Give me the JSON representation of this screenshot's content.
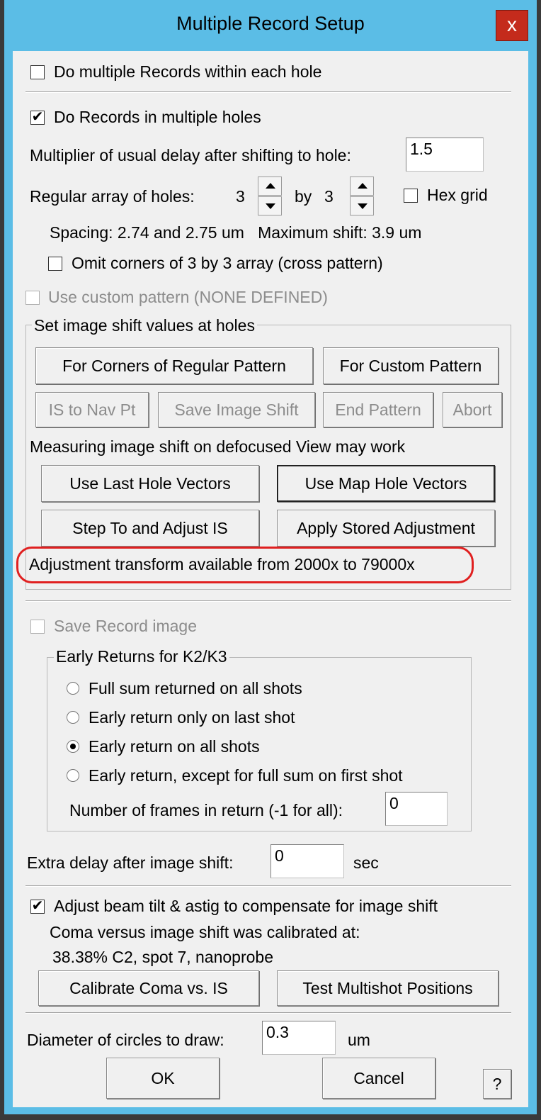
{
  "window": {
    "title": "Multiple Record Setup",
    "close_label": "x"
  },
  "within_hole": {
    "label": "Do multiple Records within each hole",
    "checked": false
  },
  "multi_holes": {
    "label": "Do Records in multiple holes",
    "checked": true
  },
  "delay_mult": {
    "label": "Multiplier of usual delay after shifting to hole:",
    "value": "1.5"
  },
  "array": {
    "label": "Regular array of holes:",
    "x": "3",
    "by_label": "by",
    "y": "3",
    "hex_label": "Hex grid",
    "hex_checked": false
  },
  "spacing_text": "Spacing: 2.74 and 2.75 um   Maximum shift: 3.9 um",
  "omit_corners": {
    "label": "Omit corners of 3 by 3 array (cross pattern)",
    "checked": false
  },
  "custom_pattern": {
    "label": "Use custom pattern (NONE DEFINED)",
    "checked": false
  },
  "is_group": {
    "title": "Set image shift values at holes",
    "corners_btn": "For Corners of Regular Pattern",
    "custom_btn": "For Custom Pattern",
    "is_nav_btn": "IS to Nav Pt",
    "save_is_btn": "Save Image Shift",
    "end_btn": "End Pattern",
    "abort_btn": "Abort",
    "note": "Measuring image shift on defocused View may work",
    "last_hole_btn": "Use Last Hole Vectors",
    "map_hole_btn": "Use Map Hole Vectors",
    "step_btn": "Step To and Adjust IS",
    "apply_btn": "Apply Stored Adjustment",
    "transform_text": "Adjustment transform available from 2000x to 79000x"
  },
  "save_record": {
    "label": "Save Record image",
    "checked": false
  },
  "early": {
    "title": "Early Returns for K2/K3",
    "options": [
      {
        "label": "Full sum returned on all shots",
        "selected": false
      },
      {
        "label": "Early return only on last shot",
        "selected": false
      },
      {
        "label": "Early return on all shots",
        "selected": true
      },
      {
        "label": "Early return, except for full sum on first shot",
        "selected": false
      }
    ],
    "frames_label": "Number of frames in return (-1 for all):",
    "frames_value": "0"
  },
  "extra_delay": {
    "label": "Extra delay after image shift:",
    "value": "0",
    "unit": "sec"
  },
  "beam_tilt": {
    "label": "Adjust beam tilt & astig to compensate for image shift",
    "checked": true,
    "line1": "Coma versus image shift was calibrated at:",
    "line2": "38.38% C2, spot 7, nanoprobe",
    "calibrate_btn": "Calibrate Coma vs. IS",
    "test_btn": "Test Multishot Positions"
  },
  "circles": {
    "label": "Diameter of circles to draw:",
    "value": "0.3",
    "unit": "um"
  },
  "footer": {
    "ok": "OK",
    "cancel": "Cancel",
    "help": "?"
  },
  "colors": {
    "title_bar": "#5bbde6",
    "close": "#c42b1c",
    "highlight": "#e02020"
  }
}
